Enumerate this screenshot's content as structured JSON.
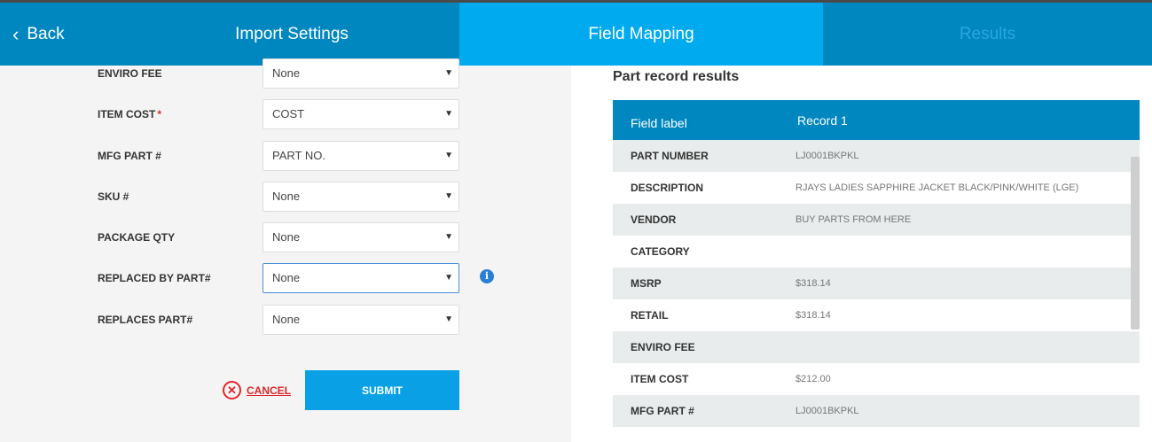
{
  "tabs": {
    "back": "Back",
    "import_settings": "Import Settings",
    "field_mapping": "Field Mapping",
    "results": "Results"
  },
  "mapping": [
    {
      "label": "ENVIRO FEE",
      "required": false,
      "value": "None"
    },
    {
      "label": "ITEM COST",
      "required": true,
      "value": "COST"
    },
    {
      "label": "MFG PART #",
      "required": false,
      "value": "PART NO."
    },
    {
      "label": "SKU #",
      "required": false,
      "value": "None"
    },
    {
      "label": "PACKAGE QTY",
      "required": false,
      "value": "None"
    },
    {
      "label": "REPLACED BY PART#",
      "required": false,
      "value": "None"
    },
    {
      "label": "REPLACES PART#",
      "required": false,
      "value": "None"
    }
  ],
  "required_mark": "*",
  "actions": {
    "cancel": "CANCEL",
    "submit": "SUBMIT"
  },
  "results": {
    "title": "Part record results",
    "headers": [
      "Field label",
      "Record 1"
    ],
    "rows": [
      {
        "field": "PART NUMBER",
        "value": "LJ0001BKPKL"
      },
      {
        "field": "DESCRIPTION",
        "value": "RJAYS LADIES SAPPHIRE JACKET BLACK/PINK/WHITE (LGE)"
      },
      {
        "field": "VENDOR",
        "value": "BUY PARTS FROM HERE"
      },
      {
        "field": "CATEGORY",
        "value": ""
      },
      {
        "field": "MSRP",
        "value": "$318.14"
      },
      {
        "field": "RETAIL",
        "value": "$318.14"
      },
      {
        "field": "ENVIRO FEE",
        "value": ""
      },
      {
        "field": "ITEM COST",
        "value": "$212.00"
      },
      {
        "field": "MFG PART #",
        "value": "LJ0001BKPKL"
      }
    ]
  },
  "icons": {
    "back": "chevron-left-icon",
    "info": "info-icon",
    "cancel": "close-circle-icon",
    "dropdown": "caret-down-icon"
  },
  "colors": {
    "header_bg": "#0087c0",
    "active_tab": "#00aaee",
    "submit_bg": "#0aa0e6",
    "cancel": "#e0262a",
    "info": "#2a7fd4"
  }
}
